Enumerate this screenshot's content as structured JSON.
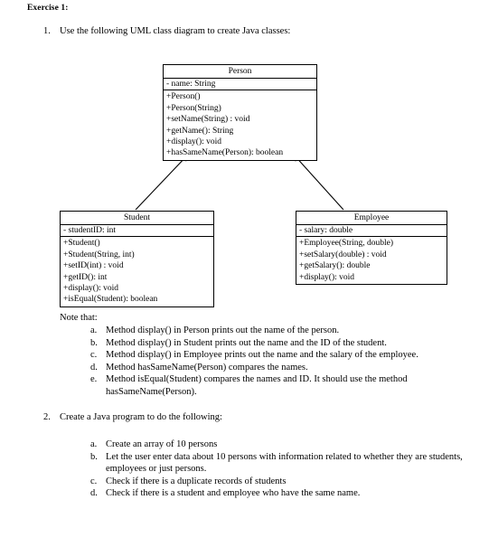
{
  "document": {
    "exercise_title": "Exercise 1:",
    "task1": {
      "number": "1.",
      "text": "Use the following UML class diagram to create Java classes:"
    },
    "task2": {
      "number": "2.",
      "text": "Create a Java program to do the following:"
    },
    "note_header": "Note that:"
  },
  "uml": {
    "person": {
      "name": "Person",
      "attributes": [
        "-  name: String"
      ],
      "operations": [
        "+Person()",
        "+Person(String)",
        "+setName(String) : void",
        "+getName(): String",
        "+display(): void",
        "+hasSameName(Person): boolean"
      ]
    },
    "student": {
      "name": "Student",
      "attributes": [
        "-  studentID: int"
      ],
      "operations": [
        "+Student()",
        "+Student(String, int)",
        "+setID(int) : void",
        "+getID(): int",
        "+display(): void",
        "+isEqual(Student): boolean"
      ]
    },
    "employee": {
      "name": "Employee",
      "attributes": [
        "-  salary: double"
      ],
      "operations": [
        "+Employee(String, double)",
        "+setSalary(double) : void",
        "+getSalary(): double",
        "+display(): void"
      ]
    },
    "relationships": [
      {
        "from": "Student",
        "to": "Person",
        "type": "inheritance"
      },
      {
        "from": "Employee",
        "to": "Person",
        "type": "inheritance"
      }
    ]
  },
  "notes": [
    {
      "letter": "a.",
      "text": "Method display() in Person prints out the name of the person."
    },
    {
      "letter": "b.",
      "text": "Method display() in Student prints out the name and the ID of the student."
    },
    {
      "letter": "c.",
      "text": "Method display() in Employee prints out the name and the salary of the employee."
    },
    {
      "letter": "d.",
      "text": "Method hasSameName(Person) compares the names."
    },
    {
      "letter": "e.",
      "text": "Method isEqual(Student) compares the names and ID. It should use the method hasSameName(Person)."
    }
  ],
  "task2_items": [
    {
      "letter": "a.",
      "text": "Create an array of 10 persons"
    },
    {
      "letter": "b.",
      "text": "Let the user enter data about 10 persons with information related to whether they are students, employees or just persons."
    },
    {
      "letter": "c.",
      "text": "Check if there is a duplicate records of students"
    },
    {
      "letter": "d.",
      "text": "Check if there is a student and employee who have the same name."
    }
  ],
  "colors": {
    "text": "#000000",
    "background": "#ffffff",
    "box_border": "#000000"
  }
}
